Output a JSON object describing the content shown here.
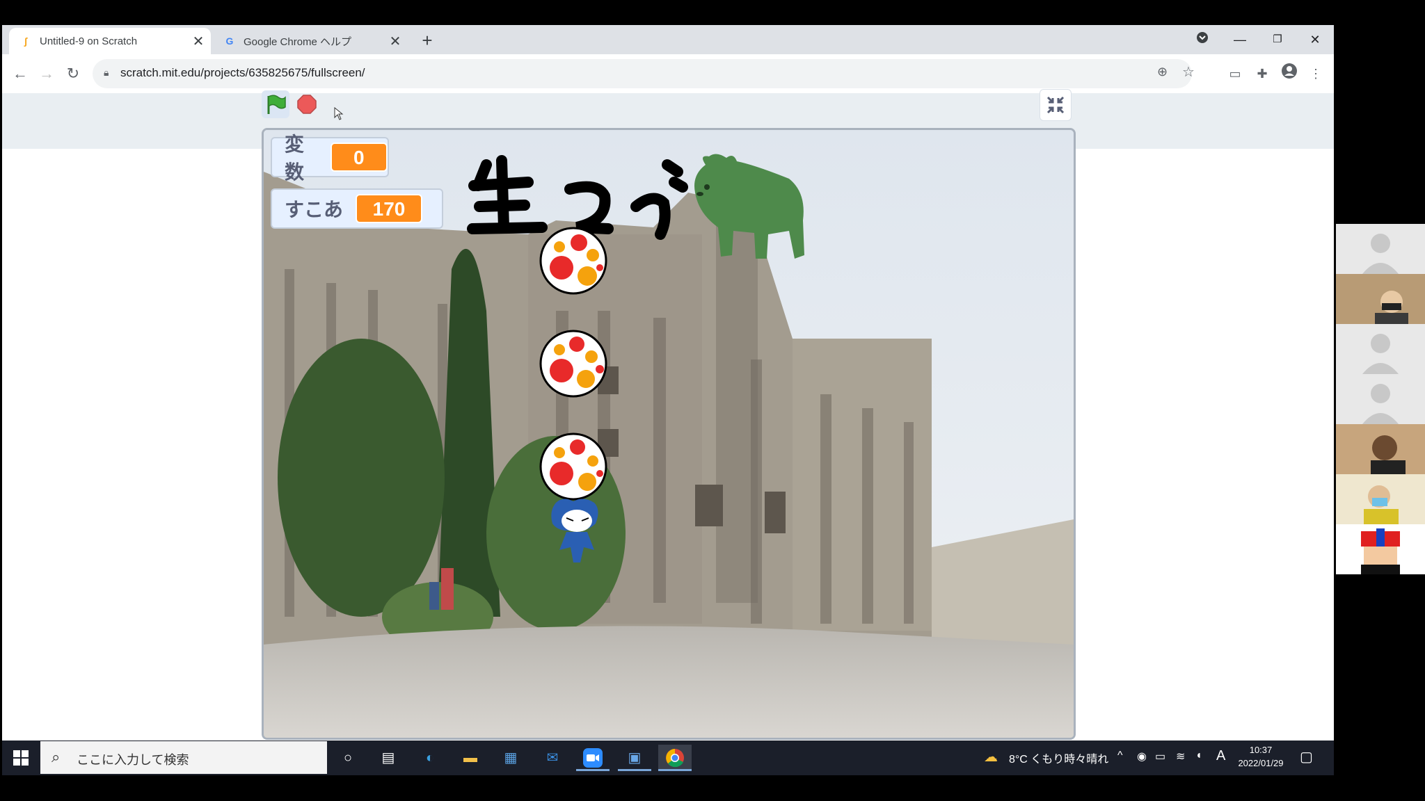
{
  "browser": {
    "tabs": [
      {
        "title": "Untitled-9 on Scratch",
        "active": true,
        "icon": "scratch-cat-icon"
      },
      {
        "title": "Google Chrome ヘルプ",
        "active": false,
        "icon": "google-g-icon"
      }
    ],
    "url": "scratch.mit.edu/projects/635825675/fullscreen/"
  },
  "stage": {
    "monitors": [
      {
        "label": "変数",
        "value": "0"
      },
      {
        "label": "すこあ",
        "value": "170"
      }
    ],
    "title_text": "生つづ"
  },
  "taskbar": {
    "search_placeholder": "ここに入力して検索",
    "weather": "8°C くもり時々晴れ",
    "ime": "A",
    "time": "10:37",
    "date": "2022/01/29"
  },
  "colors": {
    "monitor_orange": "#ff8c1a",
    "flag_green": "#3fae3a",
    "stop_red": "#ec5959",
    "bear_green": "#4e8a4b",
    "taskbar": "#1b1f2a"
  }
}
